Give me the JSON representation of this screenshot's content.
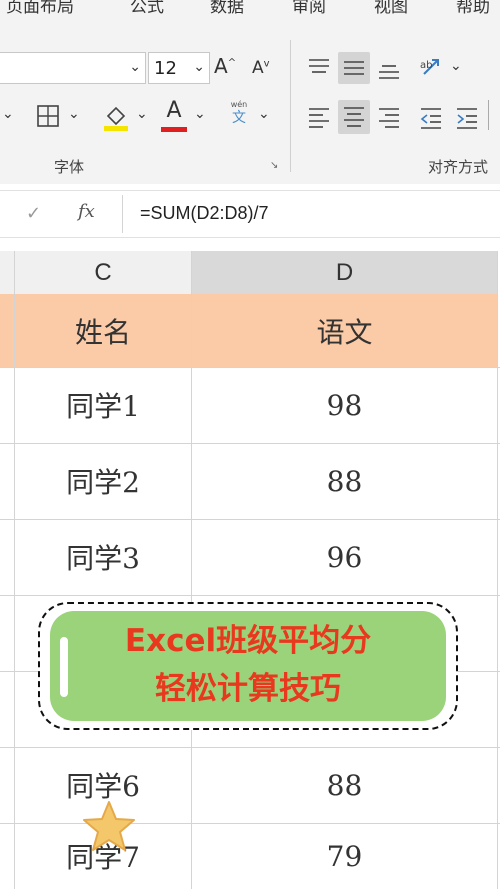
{
  "ribbon": {
    "menus": [
      "页面布局",
      "公式",
      "数据",
      "审阅",
      "视图",
      "帮助"
    ],
    "font_size": "12",
    "font_group_label": "字体",
    "align_group_label": "对齐方式",
    "wen_top": "wén",
    "wen_bottom": "文",
    "font_color": "#e02020",
    "fill_color": "#f5e400"
  },
  "formula_bar": {
    "cancel_glyph": "✓",
    "fx_label": "fx",
    "formula": "=SUM(D2:D8)/7"
  },
  "sheet": {
    "columns": [
      "C",
      "D"
    ],
    "header_row": {
      "c": "姓名",
      "d": "语文"
    },
    "rows": [
      {
        "c": "同学1",
        "d": "98"
      },
      {
        "c": "同学2",
        "d": "88"
      },
      {
        "c": "同学3",
        "d": "96"
      },
      {
        "c": "",
        "d": ""
      },
      {
        "c": "",
        "d": ""
      },
      {
        "c": "同学6",
        "d": "88"
      },
      {
        "c": "同学7",
        "d": "79"
      }
    ],
    "header_fill": "#fbcba7"
  },
  "banner": {
    "line1": "Excel班级平均分",
    "line2": "轻松计算技巧",
    "fill": "#9ad37a",
    "text_color": "#e8391f"
  }
}
